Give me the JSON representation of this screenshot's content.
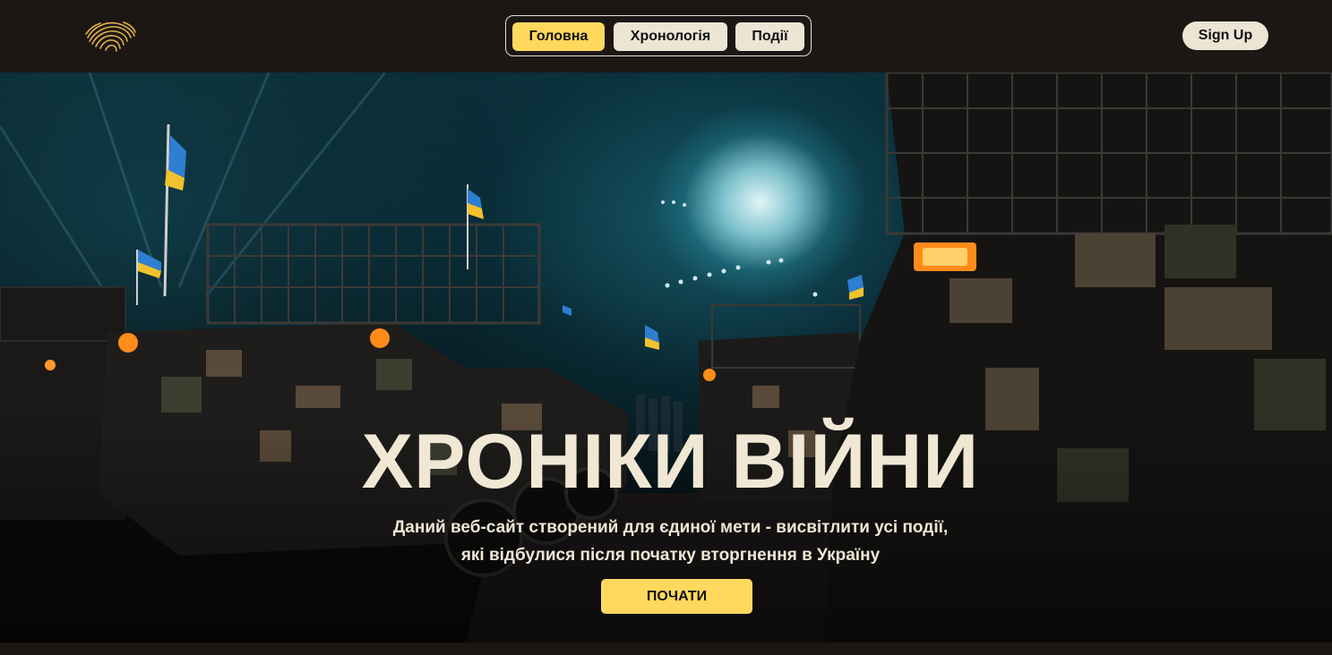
{
  "navbar": {
    "logo_icon": "fingerprint-map-icon",
    "tabs": [
      {
        "label": "Головна",
        "active": true
      },
      {
        "label": "Хронологія",
        "active": false
      },
      {
        "label": "Події",
        "active": false
      }
    ],
    "signup_label": "Sign Up"
  },
  "hero": {
    "title": "ХРОНІКИ ВІЙНИ",
    "subtitle_line1": "Даний веб-сайт створений для єдиної мети - висвітлити усі події,",
    "subtitle_line2": "які відбулися після початку вторгнення в Україну",
    "cta_label": "ПОЧАТИ",
    "background_icon": "military-parade-night-photo"
  },
  "colors": {
    "accent": "#ffd95e",
    "pill_bg": "#ece5d4",
    "nav_bg": "#1c1715",
    "text_light": "#efe7d3"
  }
}
